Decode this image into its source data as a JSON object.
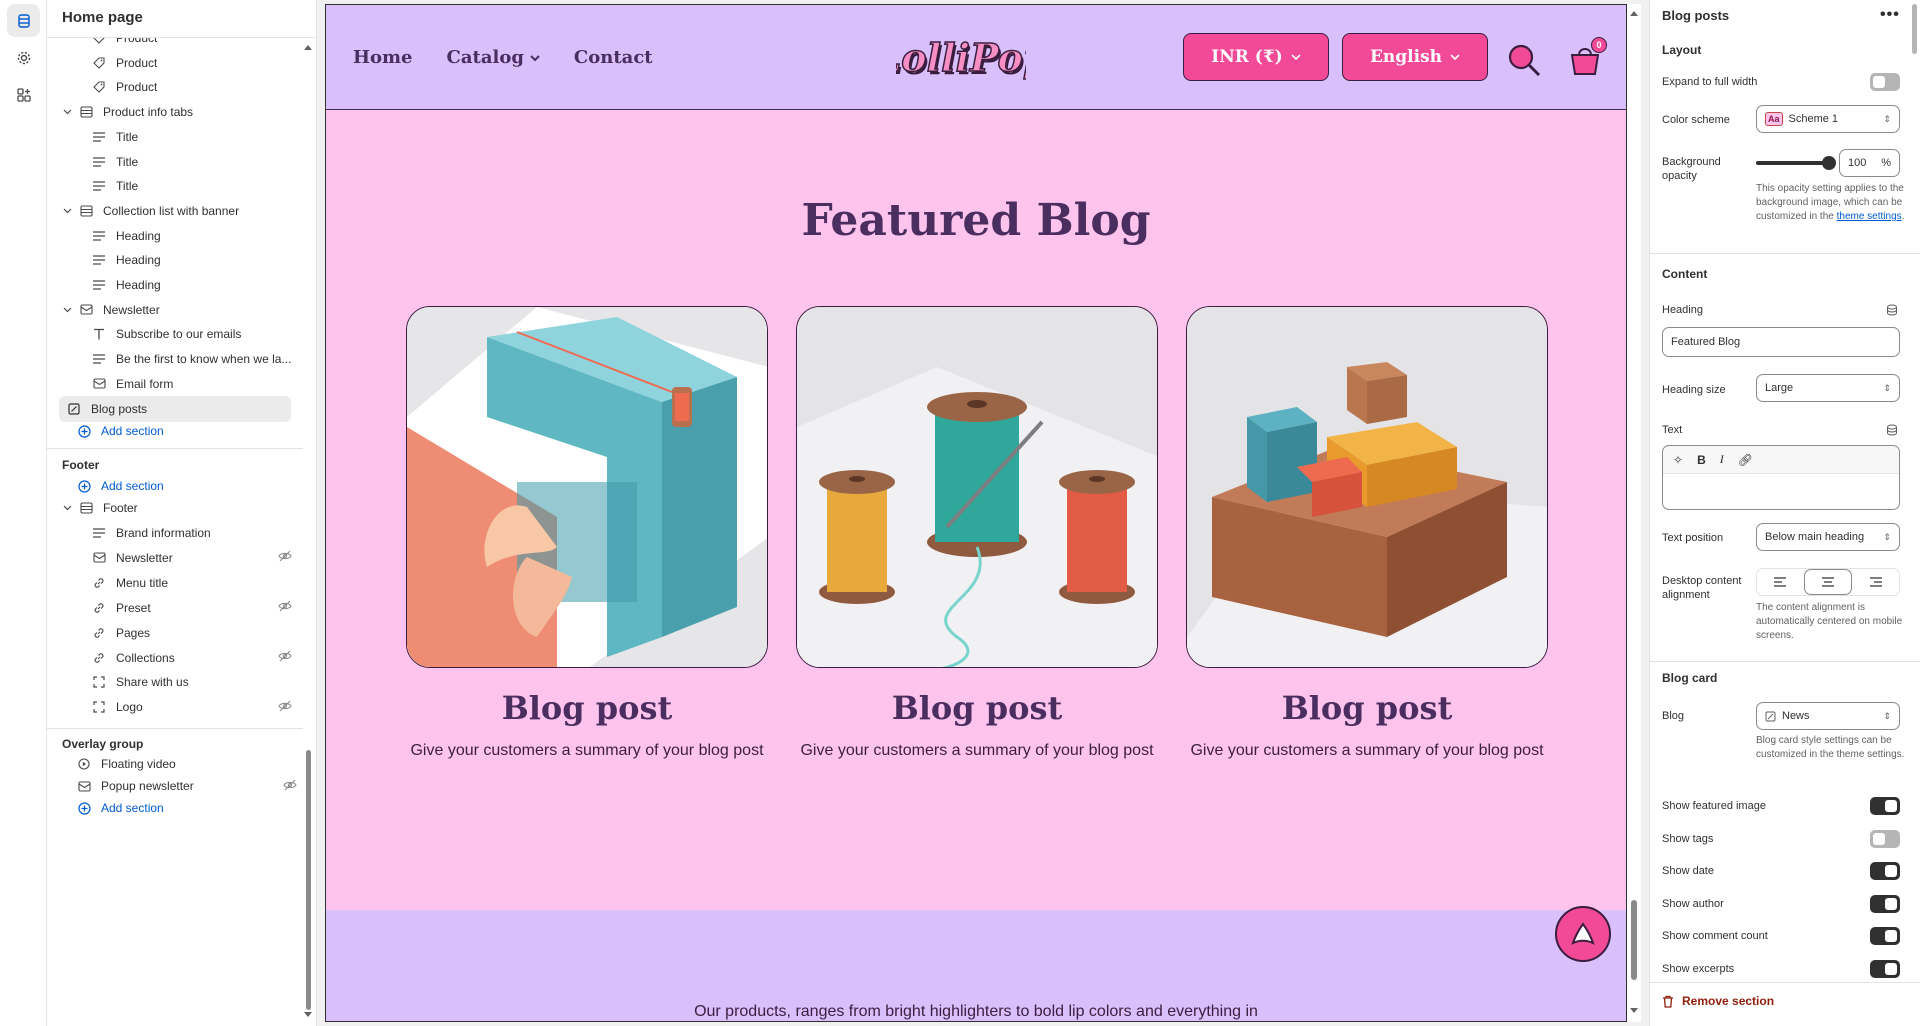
{
  "editor": {
    "page_title": "Home page"
  },
  "tree": {
    "items": [
      {
        "level": 2,
        "icon": "tag-icon",
        "label": "Product"
      },
      {
        "level": 2,
        "icon": "tag-icon",
        "label": "Product"
      },
      {
        "level": 2,
        "icon": "tag-icon",
        "label": "Product"
      },
      {
        "level": 1,
        "icon": "section-icon",
        "label": "Product info tabs"
      },
      {
        "level": 2,
        "icon": "text-icon",
        "label": "Title"
      },
      {
        "level": 2,
        "icon": "text-icon",
        "label": "Title"
      },
      {
        "level": 2,
        "icon": "text-icon",
        "label": "Title"
      },
      {
        "level": 1,
        "icon": "section-icon",
        "label": "Collection list with banner"
      },
      {
        "level": 2,
        "icon": "text-icon",
        "label": "Heading"
      },
      {
        "level": 2,
        "icon": "text-icon",
        "label": "Heading"
      },
      {
        "level": 2,
        "icon": "text-icon",
        "label": "Heading"
      },
      {
        "level": 1,
        "icon": "mail-icon",
        "label": "Newsletter"
      },
      {
        "level": 2,
        "icon": "type-icon",
        "label": "Subscribe to our emails"
      },
      {
        "level": 2,
        "icon": "text-icon",
        "label": "Be the first to know when we la..."
      },
      {
        "level": 2,
        "icon": "mail-icon",
        "label": "Email form"
      }
    ],
    "selected": "Blog posts",
    "add_section": "Add section",
    "footer_group": "Footer",
    "footer_section": "Footer",
    "footer_items": [
      {
        "icon": "text-icon",
        "label": "Brand information",
        "hidden": false
      },
      {
        "icon": "mail-icon",
        "label": "Newsletter",
        "hidden": true
      },
      {
        "icon": "link-icon",
        "label": "Menu title",
        "hidden": false
      },
      {
        "icon": "link-icon",
        "label": "Preset",
        "hidden": true
      },
      {
        "icon": "link-icon",
        "label": "Pages",
        "hidden": false
      },
      {
        "icon": "link-icon",
        "label": "Collections",
        "hidden": true
      },
      {
        "icon": "frame-icon",
        "label": "Share with us",
        "hidden": false
      },
      {
        "icon": "frame-icon",
        "label": "Logo",
        "hidden": true
      }
    ],
    "overlay_group": "Overlay group",
    "overlay_items": [
      {
        "icon": "play-icon",
        "label": "Floating video",
        "hidden": false
      },
      {
        "icon": "mail-icon",
        "label": "Popup newsletter",
        "hidden": true
      }
    ]
  },
  "store": {
    "nav": [
      "Home",
      "Catalog",
      "Contact"
    ],
    "logo_text": "LolliPop",
    "currency": "INR (₹)",
    "language": "English",
    "cart_count": "0",
    "featured_title": "Featured Blog",
    "cards": [
      {
        "title": "Blog post",
        "text": "Give your customers a summary of your blog post"
      },
      {
        "title": "Blog post",
        "text": "Give your customers a summary of your blog post"
      },
      {
        "title": "Blog post",
        "text": "Give your customers a summary of your blog post"
      }
    ],
    "band_text": "Our products, ranges from bright highlighters to bold lip colors and everything in",
    "colors": {
      "header": "#d9bffc",
      "body": "#ffc4ee",
      "accent": "#f34a98",
      "ink": "#4a2e5f"
    }
  },
  "panel": {
    "title": "Blog posts",
    "more": "•••",
    "layout_label": "Layout",
    "expand_label": "Expand to full width",
    "expand_on": false,
    "color_scheme_label": "Color scheme",
    "color_scheme_value": "Scheme 1",
    "color_scheme_swatch": "Aa",
    "bg_opacity_label": "Background opacity",
    "bg_opacity_value": "100",
    "bg_opacity_unit": "%",
    "bg_opacity_help": "This opacity setting applies to the background image, which can be customized in the",
    "bg_opacity_link": "theme settings",
    "content_label": "Content",
    "heading_label": "Heading",
    "heading_value": "Featured Blog",
    "heading_size_label": "Heading size",
    "heading_size_value": "Large",
    "text_label": "Text",
    "text_position_label": "Text position",
    "text_position_value": "Below main heading",
    "alignment_label": "Desktop content alignment",
    "alignment_help": "The content alignment is automatically centered on mobile screens.",
    "blog_card_label": "Blog card",
    "blog_label": "Blog",
    "blog_value": "News",
    "blog_help": "Blog card style settings can be customized in the theme settings.",
    "toggles": [
      {
        "label": "Show featured image",
        "on": true
      },
      {
        "label": "Show tags",
        "on": false
      },
      {
        "label": "Show date",
        "on": true
      },
      {
        "label": "Show author",
        "on": true
      },
      {
        "label": "Show comment count",
        "on": true
      },
      {
        "label": "Show excerpts",
        "on": true
      }
    ],
    "remove_label": "Remove section"
  }
}
